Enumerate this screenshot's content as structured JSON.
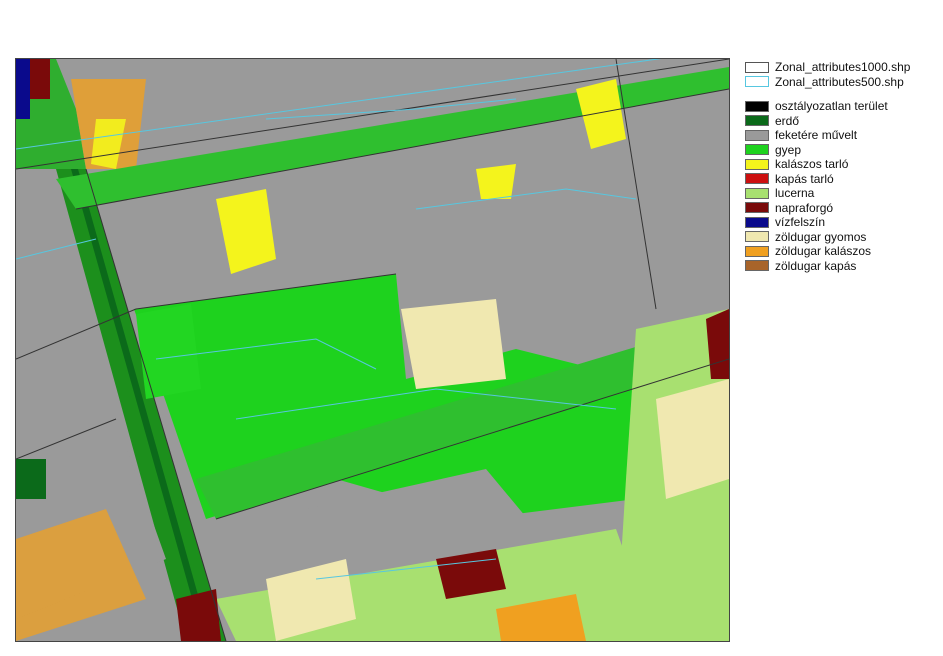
{
  "legend": {
    "layers": [
      {
        "label": "Zonal_attributes1000.shp",
        "color": "#555555"
      },
      {
        "label": "Zonal_attributes500.shp",
        "color": "#57c7e0"
      }
    ],
    "classes": [
      {
        "label": "osztályozatlan terület",
        "color": "#000000"
      },
      {
        "label": "erdő",
        "color": "#0b6a1a"
      },
      {
        "label": "feketére művelt",
        "color": "#9a9a9a"
      },
      {
        "label": "gyep",
        "color": "#1ed21e"
      },
      {
        "label": "kalászos tarló",
        "color": "#f4f41c"
      },
      {
        "label": "kapás tarló",
        "color": "#cc1010"
      },
      {
        "label": "lucerna",
        "color": "#a8e070"
      },
      {
        "label": "napraforgó",
        "color": "#7a0a0a"
      },
      {
        "label": "vízfelszín",
        "color": "#0a0a8c"
      },
      {
        "label": "zöldugar gyomos",
        "color": "#f0e8b0"
      },
      {
        "label": "zöldugar kalászos",
        "color": "#f0a020"
      },
      {
        "label": "zöldugar kapás",
        "color": "#a8642a"
      }
    ]
  }
}
